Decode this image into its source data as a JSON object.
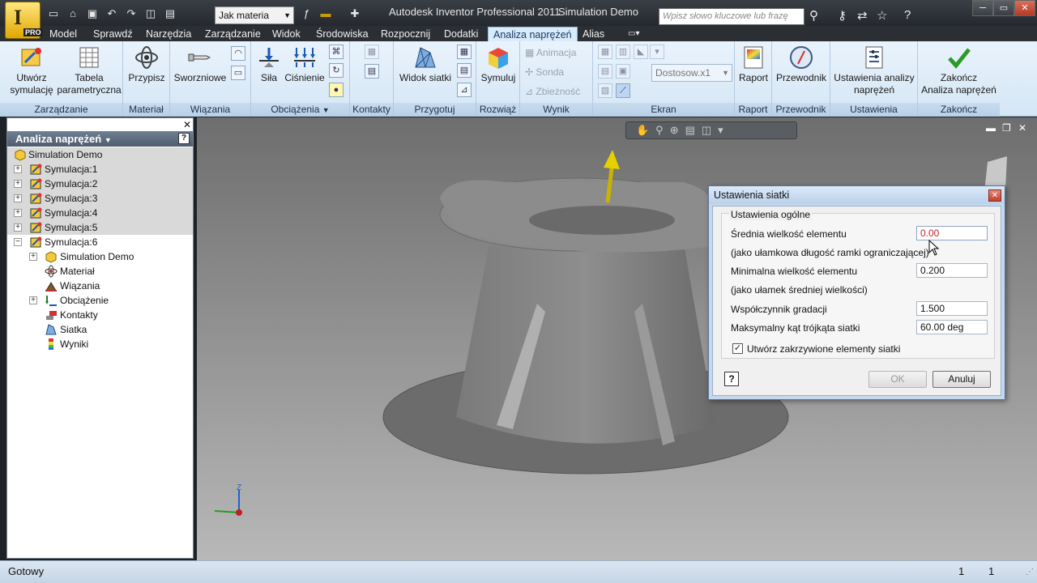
{
  "window": {
    "app_title": "Autodesk Inventor Professional 2011",
    "doc_title": "Simulation Demo",
    "logo_letter": "I",
    "logo_badge": "PRO",
    "material_combo": "Jak materia",
    "search_placeholder": "Wpisz słowo kluczowe lub frazę"
  },
  "tabs": [
    "Model",
    "Sprawdź",
    "Narzędzia",
    "Zarządzanie",
    "Widok",
    "Środowiska",
    "Rozpocznij",
    "Dodatki",
    "Analiza naprężeń",
    "Alias"
  ],
  "ribbon": {
    "zarzadzanie": {
      "footer": "Zarządzanie",
      "btn1": "Utwórz",
      "btn1b": "symulację",
      "btn2": "Tabela",
      "btn2b": "parametryczna"
    },
    "material": {
      "footer": "Materiał",
      "btn": "Przypisz"
    },
    "wiazania": {
      "footer": "Wiązania",
      "btn": "Sworzniowe"
    },
    "obciazenia": {
      "footer": "Obciążenia",
      "btn1": "Siła",
      "btn2": "Ciśnienie"
    },
    "kontakty": {
      "footer": "Kontakty"
    },
    "przygotuj": {
      "footer": "Przygotuj",
      "btn": "Widok siatki"
    },
    "rozwiaz": {
      "footer": "Rozwiąż",
      "btn": "Symuluj"
    },
    "wynik": {
      "footer": "Wynik",
      "item1": "Animacja",
      "item2": "Sonda",
      "item3": "Zbieżność"
    },
    "ekran": {
      "footer": "Ekran",
      "combo": "Dostosow.x1"
    },
    "raport": {
      "footer": "Raport",
      "btn": "Raport"
    },
    "przewodnik": {
      "footer": "Przewodnik",
      "btn": "Przewodnik"
    },
    "ustawienia": {
      "footer": "Ustawienia",
      "btn1": "Ustawienia analizy",
      "btn1b": "naprężeń"
    },
    "zakoncz": {
      "footer": "Zakończ",
      "btn1": "Zakończ",
      "btn1b": "Analiza naprężeń"
    }
  },
  "browser": {
    "header": "Analiza naprężeń",
    "items": [
      {
        "label": "Simulation Demo"
      },
      {
        "label": "Symulacja:1"
      },
      {
        "label": "Symulacja:2"
      },
      {
        "label": "Symulacja:3"
      },
      {
        "label": "Symulacja:4"
      },
      {
        "label": "Symulacja:5"
      },
      {
        "label": "Symulacja:6"
      },
      {
        "label": "Simulation Demo"
      },
      {
        "label": "Materiał"
      },
      {
        "label": "Wiązania"
      },
      {
        "label": "Obciążenie"
      },
      {
        "label": "Kontakty"
      },
      {
        "label": "Siatka"
      },
      {
        "label": "Wyniki"
      }
    ]
  },
  "dialog": {
    "title": "Ustawienia siatki",
    "group": "Ustawienia ogólne",
    "f1_label": "Średnia wielkość elementu",
    "f1_value": "0.00",
    "f1_note": "(jako ułamkowa długość ramki ograniczającej)",
    "f2_label": "Minimalna wielkość elementu",
    "f2_value": "0.200",
    "f2_note": "(jako ułamek średniej wielkości)",
    "f3_label": "Współczynnik gradacji",
    "f3_value": "1.500",
    "f4_label": "Maksymalny kąt trójkąta siatki",
    "f4_value": "60.00 deg",
    "checkbox_label": "Utwórz zakrzywione elementy siatki",
    "checkbox_checked": true,
    "ok": "OK",
    "cancel": "Anuluj"
  },
  "status": {
    "left": "Gotowy",
    "num1": "1",
    "num2": "1"
  },
  "colors": {
    "accent": "#d9ecfa",
    "ribbon_footer": "#c8dcef",
    "error_text": "#c0202a"
  }
}
